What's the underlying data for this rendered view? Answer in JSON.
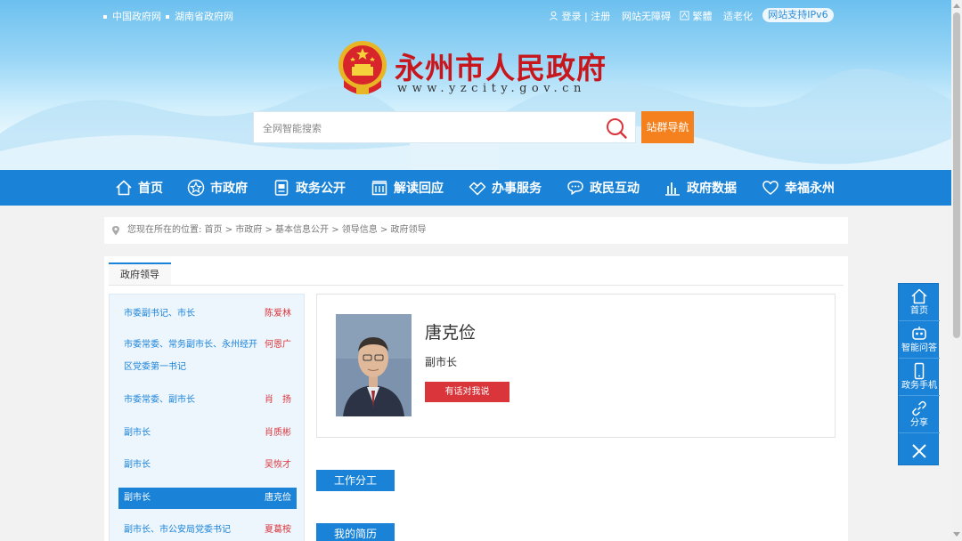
{
  "topbar": {
    "left_links": [
      "中国政府网",
      "湖南省政府网"
    ],
    "login": "登录 | 注册",
    "accessibility": "网站无障碍",
    "traditional": "繁體",
    "elderly": "适老化",
    "ipv6": "网站支持IPv6"
  },
  "site": {
    "title": "永州市人民政府",
    "domain": "www.yzcity.gov.cn"
  },
  "search": {
    "placeholder": "全网智能搜索",
    "nav_button": "站群导航"
  },
  "nav": {
    "items": [
      "首页",
      "市政府",
      "政务公开",
      "解读回应",
      "办事服务",
      "政民互动",
      "政府数据",
      "幸福永州"
    ]
  },
  "breadcrumb": {
    "text": "您现在所在的位置:   首页 > 市政府 > 基本信息公开 > 领导信息 > 政府领导"
  },
  "tab": {
    "label": "政府领导"
  },
  "leaders": [
    {
      "role": "市委副书记、市长",
      "name": "陈爱林"
    },
    {
      "role": "市委常委、常务副市长、永州经开区党委第一书记",
      "role_line1": "市委常委、常务副市长、永州经开",
      "role_line2": "区党委第一书记",
      "name": "何恩广"
    },
    {
      "role": "市委常委、副市长",
      "name": "肖　扬"
    },
    {
      "role": "副市长",
      "name": "肖质彬"
    },
    {
      "role": "副市长",
      "name": "吴恢才"
    },
    {
      "role": "副市长",
      "name": "唐克俭"
    },
    {
      "role": "副市长、市公安局党委书记",
      "name": "夏葛桉"
    }
  ],
  "profile": {
    "name": "唐克俭",
    "title": "副市长",
    "button": "有话对我说"
  },
  "sections": {
    "work": "工作分工",
    "resume": "我的简历"
  },
  "float_bar": {
    "home": "首页",
    "qa": "智能问答",
    "mobile": "政务手机",
    "share": "分享"
  },
  "colors": {
    "primary": "#1a83d8",
    "accent_red": "#c8161d",
    "orange": "#f5811e"
  }
}
